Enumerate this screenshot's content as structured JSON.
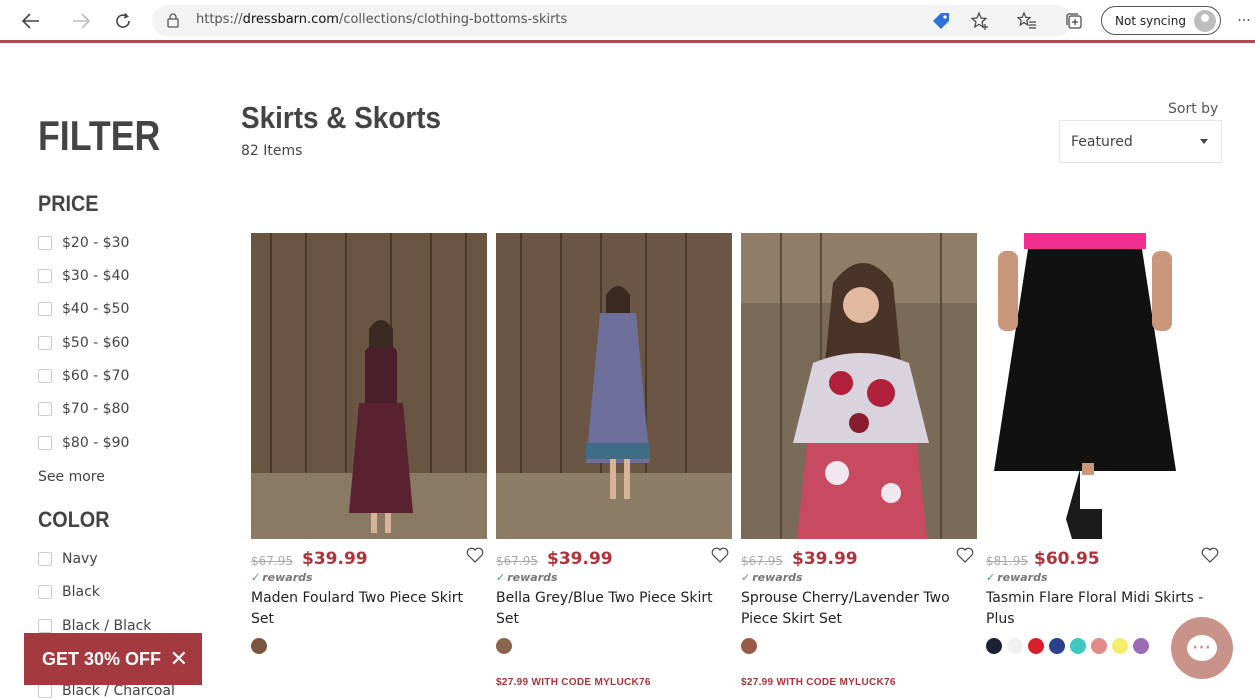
{
  "browser": {
    "url_prefix": "https://",
    "url_host": "dressbarn.com",
    "url_path": "/collections/clothing-bottoms-skirts",
    "sync_label": "Not syncing",
    "more_label": "···"
  },
  "sidebar": {
    "filter_title": "FILTER",
    "price_title": "PRICE",
    "price_options": [
      "$20 - $30",
      "$30 - $40",
      "$40 - $50",
      "$50 - $60",
      "$60 - $70",
      "$70 - $80",
      "$80 - $90"
    ],
    "see_more": "See more",
    "color_title": "COLOR",
    "color_options": [
      "Navy",
      "Black",
      "Black / Black",
      "Black / Charcoal"
    ]
  },
  "promo": {
    "label": "GET 30% OFF",
    "close": "✕"
  },
  "header": {
    "title": "Skirts & Skorts",
    "count": "82 Items",
    "sort_label": "Sort by",
    "sort_value": "Featured"
  },
  "products": [
    {
      "old_price": "$67.95",
      "new_price": "$39.99",
      "rewards": "rewards",
      "name": "Maden Foulard Two Piece Skirt Set",
      "swatches": [
        "#7a5640"
      ],
      "code": "",
      "image": "woman-dark-dress-barn"
    },
    {
      "old_price": "$67.95",
      "new_price": "$39.99",
      "rewards": "rewards",
      "name": "Bella Grey/Blue Two Piece Skirt Set",
      "swatches": [
        "#8a6650"
      ],
      "code": "$27.99 WITH CODE MYLUCK76",
      "image": "woman-blue-dress-barn"
    },
    {
      "old_price": "$67.95",
      "new_price": "$39.99",
      "rewards": "rewards",
      "name": "Sprouse Cherry/Lavender Two Piece Skirt Set",
      "swatches": [
        "#9a5a48"
      ],
      "code": "$27.99 WITH CODE MYLUCK76",
      "image": "woman-floral-dress-barn"
    },
    {
      "old_price": "$81.95",
      "new_price": "$60.95",
      "rewards": "rewards",
      "name": "Tasmin Flare Floral Midi Skirts - Plus",
      "swatches": [
        "#1d2233",
        "#f0f0f0",
        "#d81e2a",
        "#2b3f8c",
        "#3fc8c0",
        "#e28a8a",
        "#f2ee6a",
        "#9c6bb3"
      ],
      "code": "",
      "image": "black-midi-skirt"
    }
  ]
}
